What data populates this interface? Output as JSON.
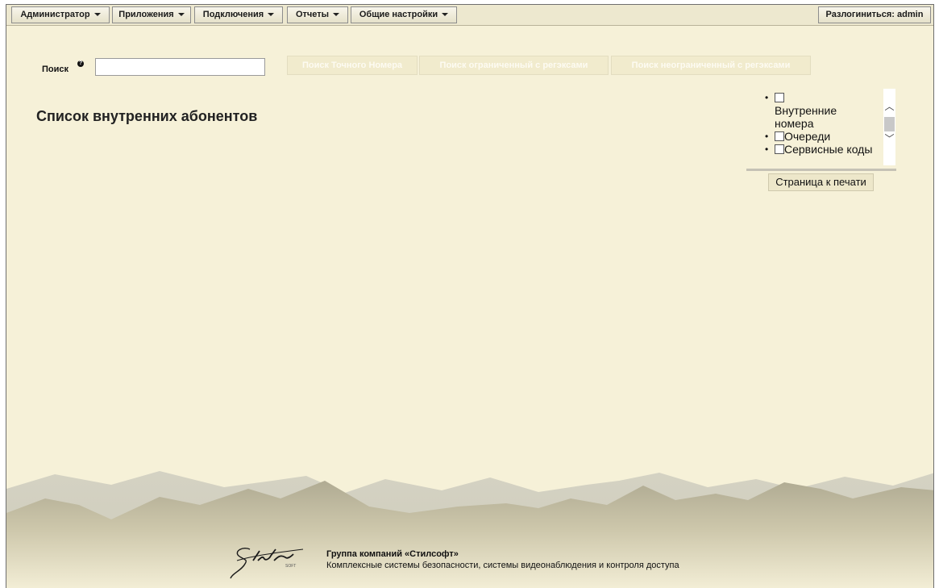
{
  "menu": {
    "items": [
      {
        "label": "Администратор"
      },
      {
        "label": "Приложения"
      },
      {
        "label": "Подключения"
      },
      {
        "label": "Отчеты"
      },
      {
        "label": "Общие настройки"
      }
    ],
    "logout": "Разлогиниться: admin"
  },
  "search": {
    "label": "Поиск",
    "value": "",
    "buttons": {
      "exact": "Поиск Точного Номера",
      "limited_regex": "Поиск ограниченный с регэксами",
      "unlimited_regex": "Поиск неограниченный с регэксами"
    }
  },
  "page": {
    "title": "Список внутренних абонентов"
  },
  "filters": {
    "items": [
      {
        "label": "Внутренние номера",
        "checked": false
      },
      {
        "label": "Очереди",
        "checked": false
      },
      {
        "label": "Сервисные коды",
        "checked": false
      }
    ],
    "print_label": "Страница к печати"
  },
  "footer": {
    "logo_text": "Stil",
    "logo_sub": "SOFT",
    "company": "Группа компаний «Стилсофт»",
    "tagline": "Комплексные системы безопасности, системы видеонаблюдения и контроля доступа"
  }
}
